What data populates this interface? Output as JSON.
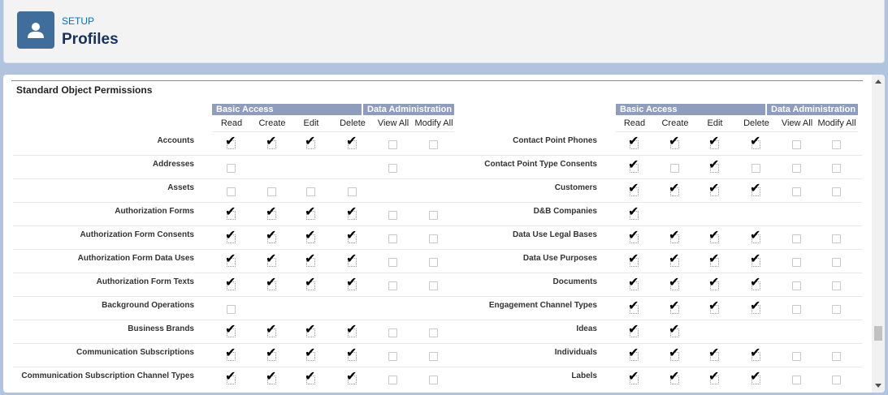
{
  "header": {
    "icon": "user-icon",
    "eyebrow": "SETUP",
    "title": "Profiles"
  },
  "section": {
    "title": "Standard Object Permissions",
    "group_basic": "Basic Access",
    "group_admin": "Data Administration",
    "columns": [
      "Read",
      "Create",
      "Edit",
      "Delete",
      "View All",
      "Modify All"
    ]
  },
  "left_rows": [
    {
      "label": "Accounts",
      "perms": [
        1,
        1,
        1,
        1,
        0,
        0
      ]
    },
    {
      "label": "Addresses",
      "perms": [
        0,
        -1,
        -1,
        -1,
        0,
        -1
      ]
    },
    {
      "label": "Assets",
      "perms": [
        0,
        0,
        0,
        0,
        -1,
        -1
      ]
    },
    {
      "label": "Authorization Forms",
      "perms": [
        1,
        1,
        1,
        1,
        0,
        0
      ]
    },
    {
      "label": "Authorization Form Consents",
      "perms": [
        1,
        1,
        1,
        1,
        0,
        0
      ]
    },
    {
      "label": "Authorization Form Data Uses",
      "perms": [
        1,
        1,
        1,
        1,
        0,
        0
      ]
    },
    {
      "label": "Authorization Form Texts",
      "perms": [
        1,
        1,
        1,
        1,
        0,
        0
      ]
    },
    {
      "label": "Background Operations",
      "perms": [
        0,
        -1,
        -1,
        -1,
        -1,
        -1
      ]
    },
    {
      "label": "Business Brands",
      "perms": [
        1,
        1,
        1,
        1,
        0,
        0
      ]
    },
    {
      "label": "Communication Subscriptions",
      "perms": [
        1,
        1,
        1,
        1,
        0,
        0
      ]
    },
    {
      "label": "Communication Subscription Channel Types",
      "perms": [
        1,
        1,
        1,
        1,
        0,
        0
      ]
    }
  ],
  "right_rows": [
    {
      "label": "Contact Point Phones",
      "perms": [
        1,
        1,
        1,
        1,
        0,
        0
      ]
    },
    {
      "label": "Contact Point Type Consents",
      "perms": [
        1,
        0,
        1,
        0,
        0,
        0
      ]
    },
    {
      "label": "Customers",
      "perms": [
        1,
        1,
        1,
        1,
        0,
        0
      ]
    },
    {
      "label": "D&B Companies",
      "perms": [
        1,
        -1,
        -1,
        -1,
        -1,
        -1
      ]
    },
    {
      "label": "Data Use Legal Bases",
      "perms": [
        1,
        1,
        1,
        1,
        0,
        0
      ]
    },
    {
      "label": "Data Use Purposes",
      "perms": [
        1,
        1,
        1,
        1,
        0,
        0
      ]
    },
    {
      "label": "Documents",
      "perms": [
        1,
        1,
        1,
        1,
        0,
        0
      ]
    },
    {
      "label": "Engagement Channel Types",
      "perms": [
        1,
        1,
        1,
        1,
        0,
        0
      ]
    },
    {
      "label": "Ideas",
      "perms": [
        1,
        1,
        -1,
        -1,
        -1,
        -1
      ]
    },
    {
      "label": "Individuals",
      "perms": [
        1,
        1,
        1,
        1,
        0,
        0
      ]
    },
    {
      "label": "Labels",
      "perms": [
        1,
        1,
        1,
        1,
        0,
        0
      ]
    }
  ],
  "colors": {
    "group_header_bg": "#8e9dbe",
    "icon_bg": "#3f6e9c",
    "eyebrow": "#0070d2"
  }
}
